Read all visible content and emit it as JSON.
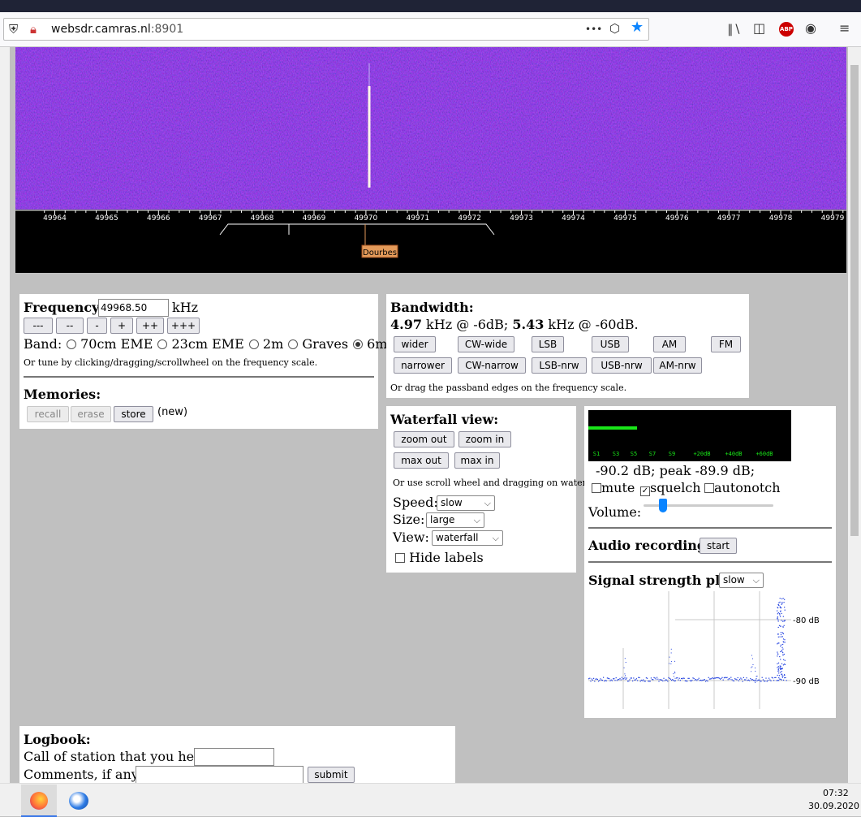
{
  "browser": {
    "url_host": "websdr.camras.nl",
    "url_port": ":8901",
    "icons": [
      "shield-icon",
      "no-lock-icon",
      "more-icon",
      "pocket-icon",
      "star-icon",
      "library-icon",
      "sidebar-icon",
      "abp-icon",
      "account-icon",
      "menu-icon"
    ],
    "abp": "ABP",
    "more": "•••"
  },
  "scale": {
    "ticks": [
      "49964",
      "49965",
      "49966",
      "49967",
      "49968",
      "49969",
      "49970",
      "49971",
      "49972",
      "49973",
      "49974",
      "49975",
      "49976",
      "49977",
      "49978",
      "49979"
    ],
    "station_label": "Dourbes"
  },
  "frequency": {
    "label": "Frequency:",
    "value": "49968.50",
    "unit": "kHz",
    "buttons": [
      "---",
      "--",
      "-",
      "+",
      "++",
      "+++"
    ],
    "band_label": "Band:",
    "bands": [
      {
        "label": "70cm EME",
        "selected": false
      },
      {
        "label": "23cm EME",
        "selected": false
      },
      {
        "label": "2m",
        "selected": false
      },
      {
        "label": "Graves",
        "selected": false
      },
      {
        "label": "6m",
        "selected": true
      }
    ],
    "hint": "Or tune by clicking/dragging/scrollwheel on the frequency scale."
  },
  "memories": {
    "label": "Memories:",
    "recall": "recall",
    "erase": "erase",
    "store": "store",
    "status": "(new)"
  },
  "bandwidth": {
    "label": "Bandwidth:",
    "v1": "4.97",
    "t1": " kHz @ -6dB; ",
    "v2": "5.43",
    "t2": " kHz @ -60dB.",
    "row1": [
      "wider",
      "CW-wide",
      "LSB",
      "USB",
      "AM",
      "FM"
    ],
    "row2": [
      "narrower",
      "CW-narrow",
      "LSB-nrw",
      "USB-nrw",
      "AM-nrw"
    ],
    "hint": "Or drag the passband edges on the frequency scale."
  },
  "waterfall": {
    "label": "Waterfall view:",
    "zoom_out": "zoom out",
    "zoom_in": "zoom in",
    "max_out": "max out",
    "max_in": "max in",
    "hint": "Or use scroll wheel and dragging on waterfall.",
    "speed_label": "Speed:",
    "speed": "slow",
    "size_label": "Size:",
    "size": "large",
    "view_label": "View:",
    "view": "waterfall",
    "hide_labels": "Hide labels"
  },
  "audio": {
    "smeter_ticks": [
      "S1",
      "S3",
      "S5",
      "S7",
      "S9",
      "+20dB",
      "+40dB",
      "+60dB"
    ],
    "smeter_level": 0.24,
    "reading": "-90.2 dB; peak   -89.9 dB;",
    "mute": "mute",
    "squelch": "squelch",
    "autonotch": "autonotch",
    "mute_checked": false,
    "squelch_checked": true,
    "autonotch_checked": false,
    "volume_label": "Volume:",
    "volume_level": 0.15,
    "recording_label": "Audio recording:",
    "recording_button": "start",
    "plot_label": "Signal strength plot:",
    "plot_speed": "slow",
    "plot_y_top": "-80 dB",
    "plot_y_bottom": "-90 dB"
  },
  "logbook": {
    "label": "Logbook:",
    "call_label": "Call of station that you hear:",
    "comments_label": "Comments, if any:",
    "submit": "submit"
  },
  "taskbar": {
    "time": "07:32",
    "date": "30.09.2020",
    "icons": [
      "firefox-icon",
      "thunderbird-icon"
    ]
  }
}
